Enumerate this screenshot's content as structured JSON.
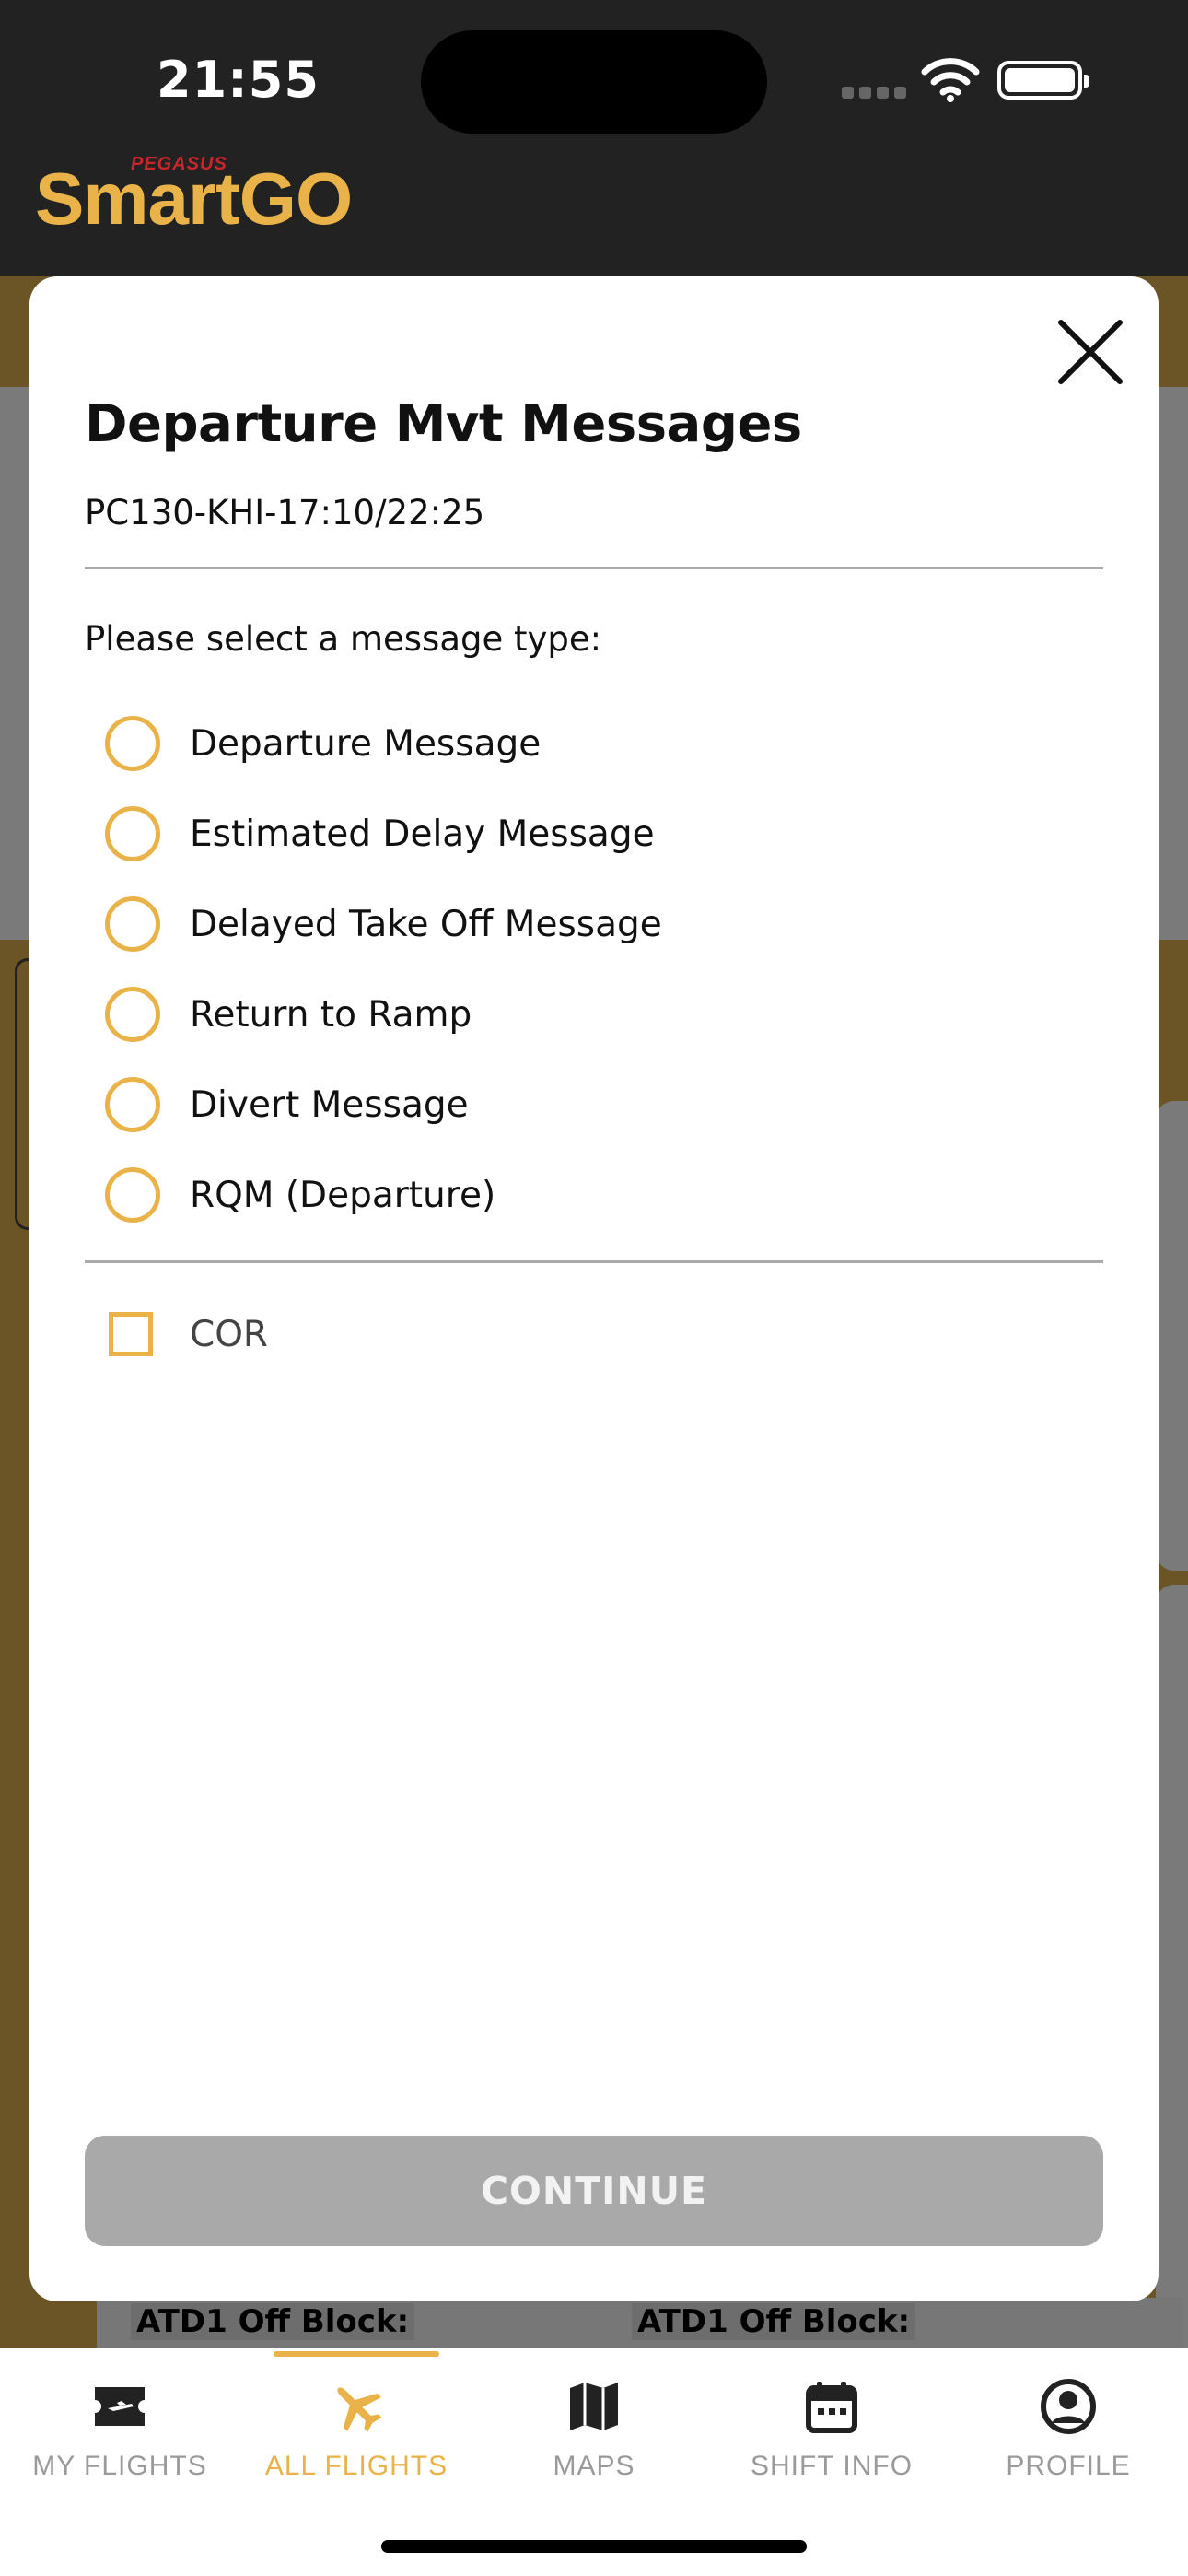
{
  "status_bar": {
    "time": "21:55"
  },
  "app": {
    "logo_small": "PEGASUS",
    "logo_main": "SmartGO"
  },
  "background": {
    "atd_label_left": "ATD1 Off Block:",
    "atd_label_right": "ATD1 Off Block:"
  },
  "modal": {
    "title": "Departure Mvt Messages",
    "flight_info": "PC130-KHI-17:10/22:25",
    "prompt": "Please select a message type:",
    "options": [
      {
        "label": "Departure Message",
        "selected": false
      },
      {
        "label": "Estimated Delay Message",
        "selected": false
      },
      {
        "label": "Delayed Take Off Message",
        "selected": false
      },
      {
        "label": "Return to Ramp",
        "selected": false
      },
      {
        "label": "Divert Message",
        "selected": false
      },
      {
        "label": "RQM (Departure)",
        "selected": false
      }
    ],
    "checkbox": {
      "label": "COR",
      "checked": false
    },
    "continue_label": "CONTINUE"
  },
  "tabs": [
    {
      "label": "MY FLIGHTS",
      "icon": "ticket-plane-icon",
      "active": false
    },
    {
      "label": "ALL FLIGHTS",
      "icon": "airplane-icon",
      "active": true
    },
    {
      "label": "MAPS",
      "icon": "map-icon",
      "active": false
    },
    {
      "label": "SHIFT INFO",
      "icon": "calendar-icon",
      "active": false
    },
    {
      "label": "PROFILE",
      "icon": "profile-icon",
      "active": false
    }
  ],
  "colors": {
    "accent": "#e9b34a",
    "header_bg": "#222222",
    "overlay_gold": "#6b5426",
    "button_disabled": "#a9a9a9"
  }
}
